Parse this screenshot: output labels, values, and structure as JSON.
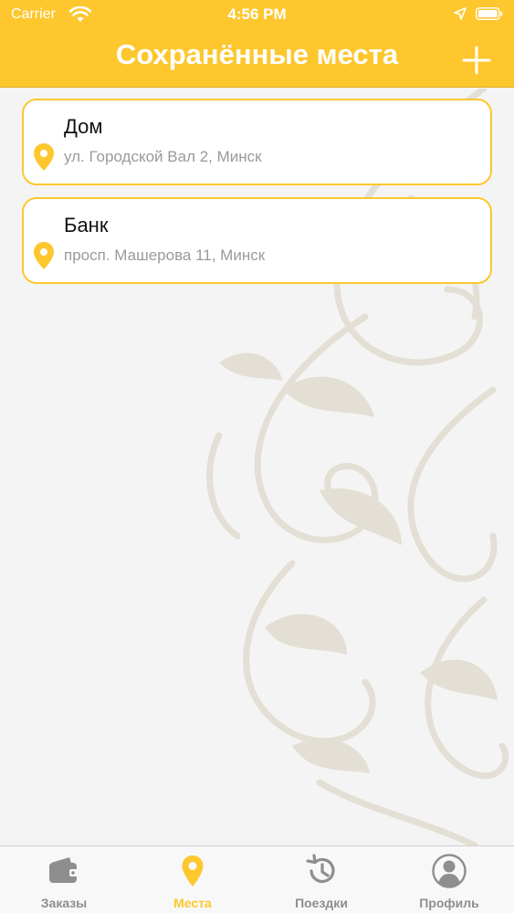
{
  "status_bar": {
    "carrier": "Carrier",
    "time": "4:56 PM"
  },
  "nav": {
    "title": "Сохранённые места",
    "add_icon": "plus-icon"
  },
  "places": [
    {
      "name": "Дом",
      "address": "ул. Городской Вал 2, Минск",
      "icon": "map-pin-icon"
    },
    {
      "name": "Банк",
      "address": "просп. Машерова 11, Минск",
      "icon": "map-pin-icon"
    }
  ],
  "tabs": [
    {
      "label": "Заказы",
      "icon": "wallet-icon",
      "active": false
    },
    {
      "label": "Места",
      "icon": "map-pin-icon",
      "active": true
    },
    {
      "label": "Поездки",
      "icon": "history-icon",
      "active": false
    },
    {
      "label": "Профиль",
      "icon": "user-icon",
      "active": false
    }
  ],
  "colors": {
    "accent": "#fdc72d",
    "inactive": "#8e8e8e",
    "background": "#f4f4f4",
    "ornament": "#e3dfd4"
  }
}
